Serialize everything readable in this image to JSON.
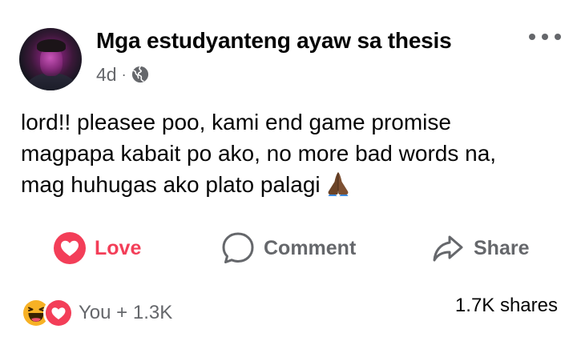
{
  "post": {
    "author": "Mga estudyanteng ayaw sa thesis",
    "timestamp": "4d",
    "separator": "·",
    "privacy_icon": "globe-icon",
    "text_lines": [
      "lord!! pleasee poo, kami end game promise",
      "magpapa kabait po ako, no more bad words na,",
      "mag huhugas ako plato palagi"
    ],
    "emoji": "folded-hands"
  },
  "actions": {
    "love_label": "Love",
    "comment_label": "Comment",
    "share_label": "Share"
  },
  "footer": {
    "reaction_count": "You + 1.3K",
    "reaction_icons": [
      "haha-icon",
      "love-icon"
    ],
    "shares": "1.7K shares"
  },
  "colors": {
    "love_red": "#f33e58",
    "secondary_text": "#65676b",
    "primary_text": "#050505"
  }
}
